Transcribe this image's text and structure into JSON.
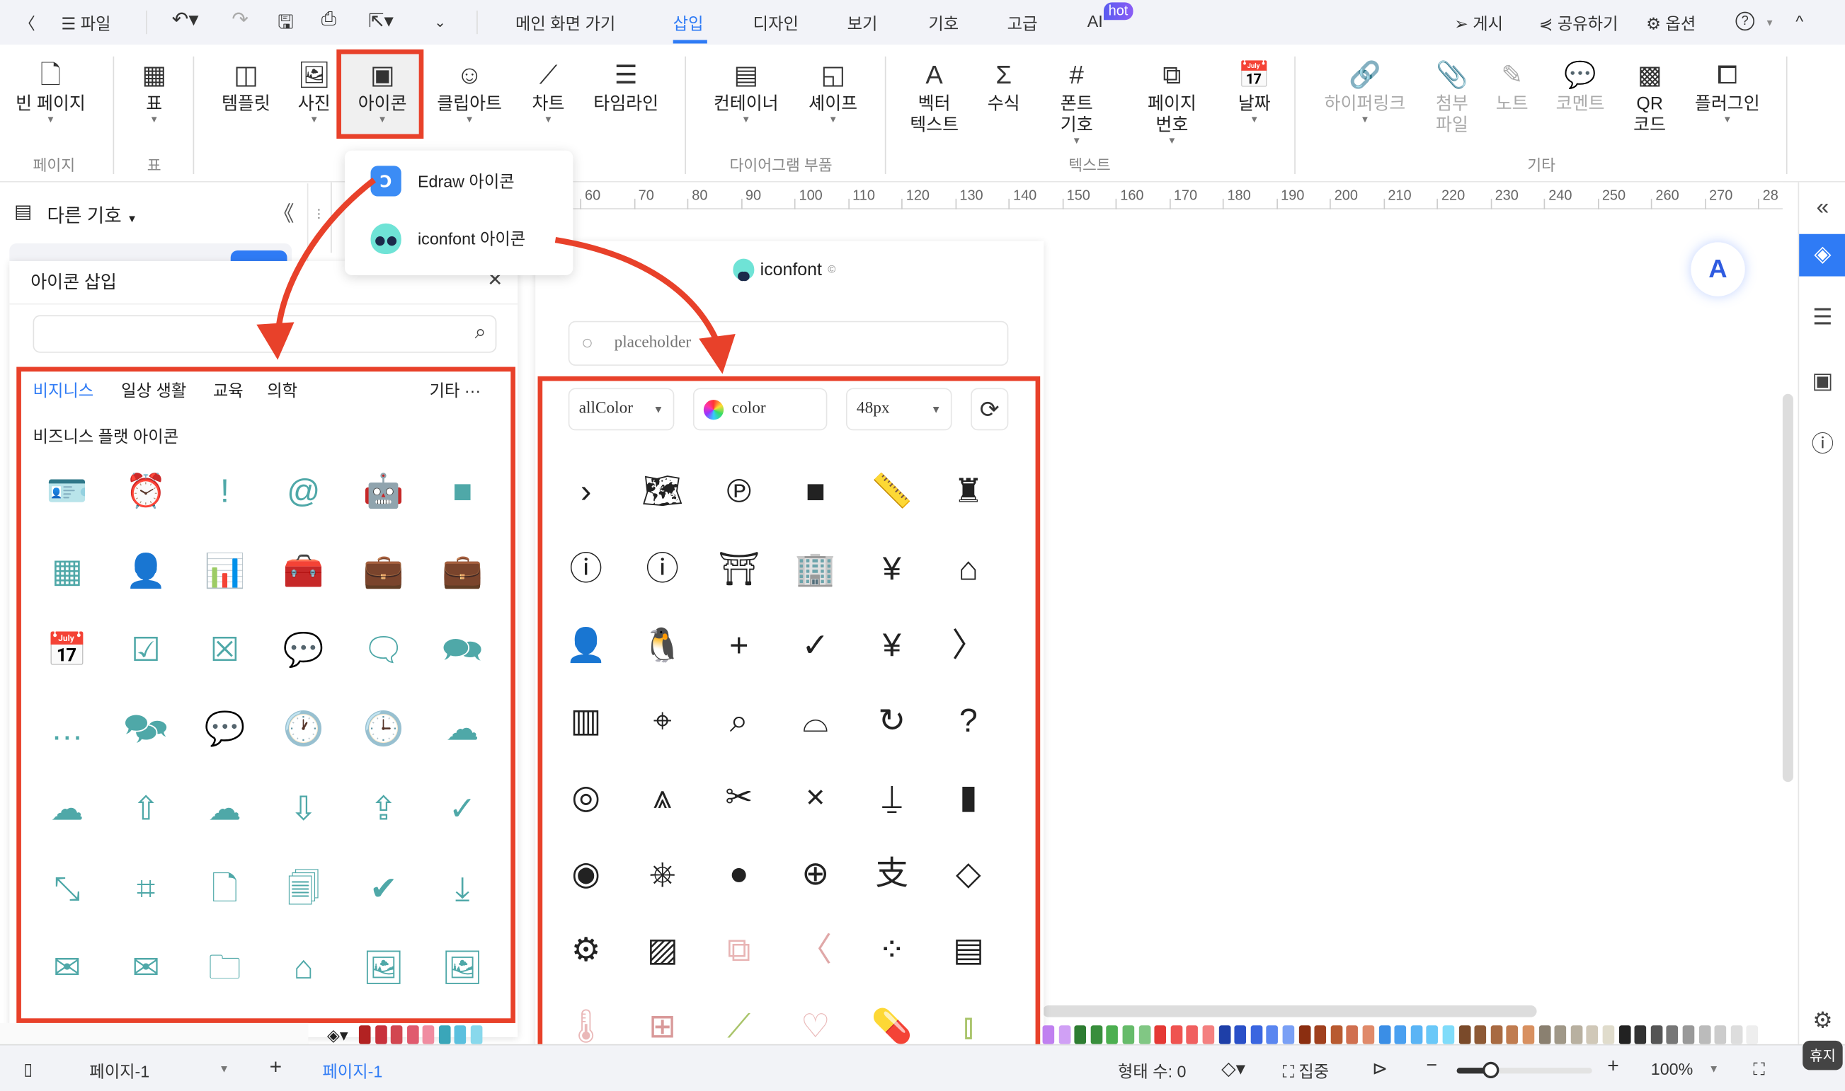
{
  "topbar": {
    "back": "〈",
    "file": "파일",
    "tabs": [
      "메인 화면 가기",
      "삽입",
      "디자인",
      "보기",
      "기호",
      "고급",
      "AI"
    ],
    "active_tab": "삽입",
    "hot": "hot",
    "publish": "게시",
    "share": "공유하기",
    "options": "옵션",
    "help": "?",
    "collapse": "^"
  },
  "ribbon": {
    "buttons": [
      {
        "name": "blank-page",
        "label": "빈 페이지",
        "icon": "page-icon"
      },
      {
        "name": "table",
        "label": "표",
        "icon": "table-icon"
      },
      {
        "name": "template",
        "label": "템플릿",
        "icon": "template-icon"
      },
      {
        "name": "photo",
        "label": "사진",
        "icon": "image-icon"
      },
      {
        "name": "icon",
        "label": "아이콘",
        "icon": "icon-icon"
      },
      {
        "name": "clipart",
        "label": "클립아트",
        "icon": "smiley-icon"
      },
      {
        "name": "chart",
        "label": "차트",
        "icon": "chart-icon"
      },
      {
        "name": "timeline",
        "label": "타임라인",
        "icon": "timeline-icon"
      },
      {
        "name": "container",
        "label": "컨테이너",
        "icon": "container-icon"
      },
      {
        "name": "shape",
        "label": "셰이프",
        "icon": "shape-icon"
      },
      {
        "name": "vector-text",
        "label": "벡터\n텍스트",
        "icon": "vector-text-icon"
      },
      {
        "name": "formula",
        "label": "수식",
        "icon": "sigma-icon"
      },
      {
        "name": "font-symbol",
        "label": "폰트\n기호",
        "icon": "hash-icon"
      },
      {
        "name": "page-number",
        "label": "페이지\n번호",
        "icon": "page-number-icon"
      },
      {
        "name": "date",
        "label": "날짜",
        "icon": "calendar-icon"
      },
      {
        "name": "hyperlink",
        "label": "하이퍼링크",
        "icon": "link-icon"
      },
      {
        "name": "attachment",
        "label": "첨부\n파일",
        "icon": "paperclip-icon"
      },
      {
        "name": "note",
        "label": "노트",
        "icon": "pen-icon"
      },
      {
        "name": "comment",
        "label": "코멘트",
        "icon": "comment-icon"
      },
      {
        "name": "qr-code",
        "label": "QR\n코드",
        "icon": "qr-icon"
      },
      {
        "name": "plugin",
        "label": "플러그인",
        "icon": "puzzle-icon"
      }
    ],
    "groups": [
      "페이지",
      "표",
      "다이어그램 부품",
      "텍스트",
      "기타"
    ]
  },
  "icon_menu": {
    "items": [
      "Edraw 아이콘",
      "iconfont 아이콘"
    ]
  },
  "left_panel": {
    "header": "다른 기호",
    "collapse": "《",
    "insert_title": "아이콘 삽입",
    "close": "✕",
    "search_placeholder": "",
    "categories": [
      "비지니스",
      "일상 생활",
      "교육",
      "의학"
    ],
    "active_category": "비지니스",
    "more": "기타 ···",
    "section_title": "비즈니스 플랫 아이콘",
    "icon_color": "#4fa8a8",
    "icons": [
      "id-card",
      "alarm-clock",
      "exclamation",
      "at-sign",
      "android",
      "apple",
      "grid-dots",
      "contact-book",
      "bar-chart",
      "toolbox",
      "briefcase-outline",
      "briefcase-filled",
      "calendar-grid",
      "calendar-check",
      "calendar-x",
      "speech-bubble",
      "callout",
      "chat-bubbles",
      "chat-dots",
      "chat-double",
      "chat-ellipsis",
      "clock-detailed",
      "clock",
      "cloud-outline",
      "cloud-filled",
      "cloud-upload-filled",
      "cloud-outline-2",
      "cloud-download-filled",
      "cloud-upload",
      "cloud-check",
      "collapse",
      "crop",
      "file",
      "files",
      "check-circle",
      "download-box",
      "mail",
      "mail-open",
      "folder",
      "house",
      "picture",
      "pictures"
    ]
  },
  "iconfont_panel": {
    "title": "iconfont",
    "search_placeholder": "placeholder",
    "color_filter": "allColor",
    "color_label": "color",
    "size": "48px",
    "icons": [
      {
        "n": "chevron-right",
        "c": "#222"
      },
      {
        "n": "map-pin",
        "c": "#222"
      },
      {
        "n": "pin-p",
        "c": "#222"
      },
      {
        "n": "video-camera",
        "c": "#222"
      },
      {
        "n": "ruler",
        "c": "#222"
      },
      {
        "n": "binder-clip",
        "c": "#222"
      },
      {
        "n": "info",
        "c": "#222"
      },
      {
        "n": "info-2",
        "c": "#222"
      },
      {
        "n": "easel",
        "c": "#222"
      },
      {
        "n": "building",
        "c": "#222"
      },
      {
        "n": "wallet-yen",
        "c": "#222"
      },
      {
        "n": "home",
        "c": "#222"
      },
      {
        "n": "contact-card",
        "c": "#222"
      },
      {
        "n": "qq",
        "c": "#222"
      },
      {
        "n": "plus",
        "c": "#222"
      },
      {
        "n": "check",
        "c": "#222"
      },
      {
        "n": "yen-transfer",
        "c": "#222"
      },
      {
        "n": "chevron-right-2",
        "c": "#222"
      },
      {
        "n": "qr-barcode",
        "c": "#222"
      },
      {
        "n": "location",
        "c": "#222"
      },
      {
        "n": "search",
        "c": "#222"
      },
      {
        "n": "shop",
        "c": "#222"
      },
      {
        "n": "refresh",
        "c": "#222"
      },
      {
        "n": "question",
        "c": "#222"
      },
      {
        "n": "chat-ring",
        "c": "#222"
      },
      {
        "n": "compass",
        "c": "#222"
      },
      {
        "n": "scissors",
        "c": "#222"
      },
      {
        "n": "close",
        "c": "#222"
      },
      {
        "n": "stamp",
        "c": "#222"
      },
      {
        "n": "tube",
        "c": "#222"
      },
      {
        "n": "disc",
        "c": "#222"
      },
      {
        "n": "wheel",
        "c": "#222"
      },
      {
        "n": "pin-filled",
        "c": "#222"
      },
      {
        "n": "plus-circle",
        "c": "#222"
      },
      {
        "n": "alipay",
        "c": "#222"
      },
      {
        "n": "eraser",
        "c": "#222"
      },
      {
        "n": "gear",
        "c": "#222"
      },
      {
        "n": "image",
        "c": "#222"
      },
      {
        "n": "external-link",
        "c": "#e8b4b4"
      },
      {
        "n": "chevron-left",
        "c": "#e0a8a8"
      },
      {
        "n": "dots-grid",
        "c": "#222"
      },
      {
        "n": "news",
        "c": "#222"
      },
      {
        "n": "thermometer",
        "c": "#eab8b8"
      },
      {
        "n": "medicine-bottle",
        "c": "#d99a9a"
      },
      {
        "n": "syringe",
        "c": "#a9c46a"
      },
      {
        "n": "heart",
        "c": "#eab8b8"
      },
      {
        "n": "pills",
        "c": "#a9c46a"
      },
      {
        "n": "test-tube",
        "c": "#a9c46a"
      }
    ]
  },
  "ruler": [
    "60",
    "70",
    "80",
    "90",
    "100",
    "110",
    "120",
    "130",
    "140",
    "150",
    "160",
    "170",
    "180",
    "190",
    "200",
    "210",
    "220",
    "230",
    "240",
    "250",
    "260",
    "270",
    "28"
  ],
  "palette": [
    "#b22222",
    "#c8323c",
    "#d24650",
    "#e05a6e",
    "#f08ca0",
    "#3aa6b9",
    "#5bc0de",
    "#88d8ec",
    "#c080f0",
    "#d0a0f5",
    "#2e7d32",
    "#388e3c",
    "#4caf50",
    "#66bb6a",
    "#81c784",
    "#e53935",
    "#ef5350",
    "#f06060",
    "#f48080",
    "#1e3fa8",
    "#2a50c8",
    "#3a66e0",
    "#5a86f0",
    "#7aa0f5",
    "#8b2e10",
    "#a0401e",
    "#b85a30",
    "#d07050",
    "#e08a6a",
    "#3a8ee6",
    "#4aa0f0",
    "#5ab4f5",
    "#6ac8f8",
    "#80dcfa",
    "#7a4a2a",
    "#8e5a36",
    "#a86a42",
    "#c07c50",
    "#d89060",
    "#8a8070",
    "#a09888",
    "#b8b0a0",
    "#d0c8b8",
    "#e0dccc",
    "#222222",
    "#333333",
    "#555555",
    "#777777",
    "#999999",
    "#bbbbbb",
    "#cccccc",
    "#dddddd",
    "#eeeeee"
  ],
  "status": {
    "page_select": "페이지-1",
    "add": "+",
    "page_tab": "페이지-1",
    "shape_count": "형태 수: 0",
    "focus": "집중",
    "zoom_minus": "−",
    "zoom_plus": "+",
    "zoom": "100%",
    "zoom_value": 100,
    "rest": "휴지"
  },
  "accent": "#2f7bf5",
  "highlight": "#e8412a"
}
